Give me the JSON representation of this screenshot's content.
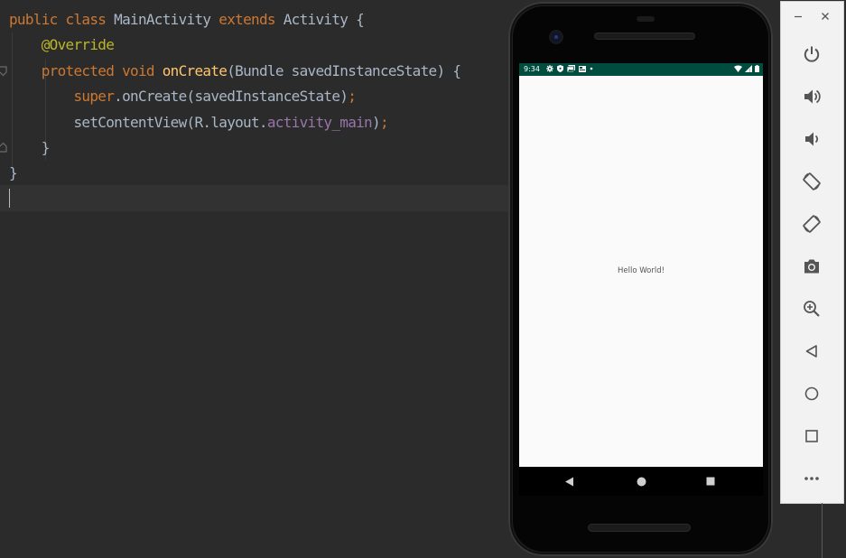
{
  "editor": {
    "lines": [
      [
        {
          "t": "public ",
          "c": "kw"
        },
        {
          "t": "class ",
          "c": "kw"
        },
        {
          "t": "MainActivity ",
          "c": "plain"
        },
        {
          "t": "extends ",
          "c": "kw"
        },
        {
          "t": "Activity {",
          "c": "plain"
        }
      ],
      [
        {
          "t": "    ",
          "c": "plain"
        },
        {
          "t": "@Override",
          "c": "ann"
        }
      ],
      [
        {
          "t": "    ",
          "c": "plain"
        },
        {
          "t": "protected ",
          "c": "kw"
        },
        {
          "t": "void ",
          "c": "kw"
        },
        {
          "t": "onCreate",
          "c": "fn"
        },
        {
          "t": "(Bundle savedInstanceState) {",
          "c": "plain"
        }
      ],
      [
        {
          "t": "        ",
          "c": "plain"
        },
        {
          "t": "super",
          "c": "kw"
        },
        {
          "t": ".onCreate(savedInstanceState)",
          "c": "plain"
        },
        {
          "t": ";",
          "c": "kw"
        }
      ],
      [
        {
          "t": "        ",
          "c": "plain"
        },
        {
          "t": "setContentView(R.layout.",
          "c": "plain"
        },
        {
          "t": "activity_main",
          "c": "field"
        },
        {
          "t": ")",
          "c": "plain"
        },
        {
          "t": ";",
          "c": "kw"
        }
      ],
      [
        {
          "t": "    }",
          "c": "plain"
        }
      ],
      [
        {
          "t": "}",
          "c": "plain"
        }
      ],
      [
        {
          "t": "",
          "c": "plain"
        }
      ]
    ]
  },
  "device": {
    "status_bar": {
      "time": "9:34",
      "left_icons": [
        "gear-icon",
        "shield-icon",
        "gallery-icon",
        "card-icon",
        "dot-icon"
      ],
      "right_icons": [
        "wifi-icon",
        "signal-icon",
        "battery-icon"
      ],
      "color": "#004d40"
    },
    "screen_text": "Hello World!",
    "nav_buttons": [
      "back-icon",
      "home-icon",
      "recents-icon"
    ]
  },
  "panel": {
    "window_controls": [
      "minimize-icon",
      "close-icon"
    ],
    "buttons": [
      "power-icon",
      "volume-up-icon",
      "volume-down-icon",
      "rotate-left-icon",
      "rotate-right-icon",
      "camera-icon",
      "zoom-icon",
      "back-icon",
      "home-icon",
      "overview-icon",
      "more-icon"
    ]
  }
}
